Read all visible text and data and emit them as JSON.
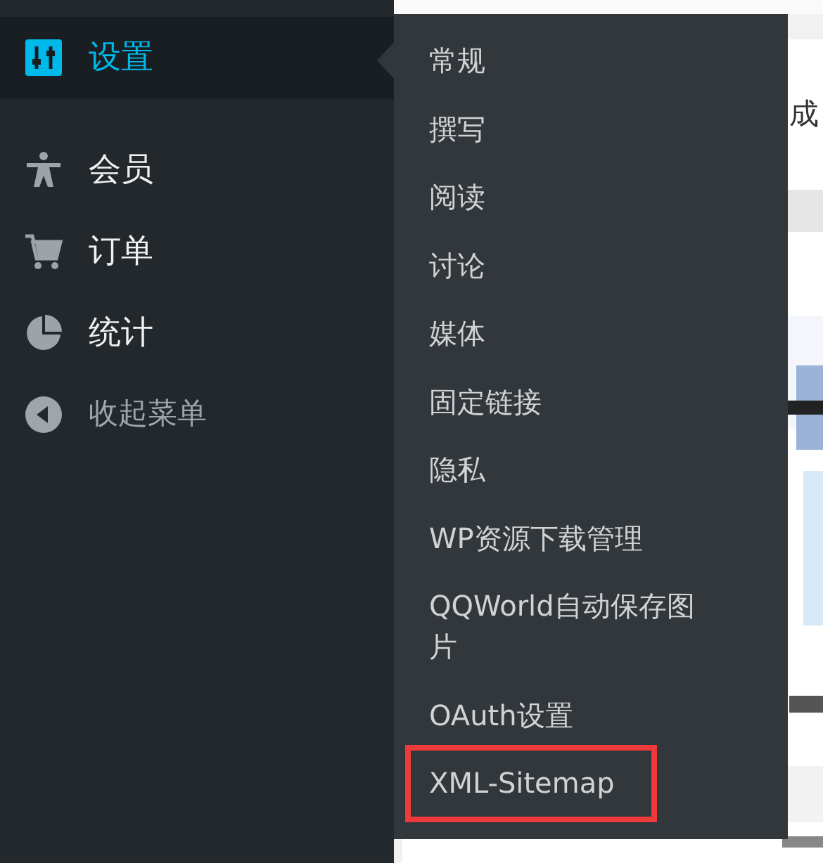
{
  "sidebar": {
    "items": [
      {
        "label": "设置",
        "kind": "settings",
        "selected": true
      },
      {
        "label": "会员",
        "kind": "person",
        "selected": false
      },
      {
        "label": "订单",
        "kind": "cart",
        "selected": false
      },
      {
        "label": "统计",
        "kind": "pie",
        "selected": false
      }
    ],
    "collapse": {
      "label": "收起菜单"
    }
  },
  "submenu": {
    "items": [
      {
        "label": "常规",
        "highlighted": false
      },
      {
        "label": "撰写",
        "highlighted": false
      },
      {
        "label": "阅读",
        "highlighted": false
      },
      {
        "label": "讨论",
        "highlighted": false
      },
      {
        "label": "媒体",
        "highlighted": false
      },
      {
        "label": "固定链接",
        "highlighted": false
      },
      {
        "label": "隐私",
        "highlighted": false
      },
      {
        "label": "WP资源下载管理",
        "highlighted": false
      },
      {
        "label": "QQWorld自动保存图片",
        "highlighted": false
      },
      {
        "label": "OAuth设置",
        "highlighted": false
      },
      {
        "label": "XML-Sitemap",
        "highlighted": true
      }
    ]
  },
  "content": {
    "text": "成"
  }
}
